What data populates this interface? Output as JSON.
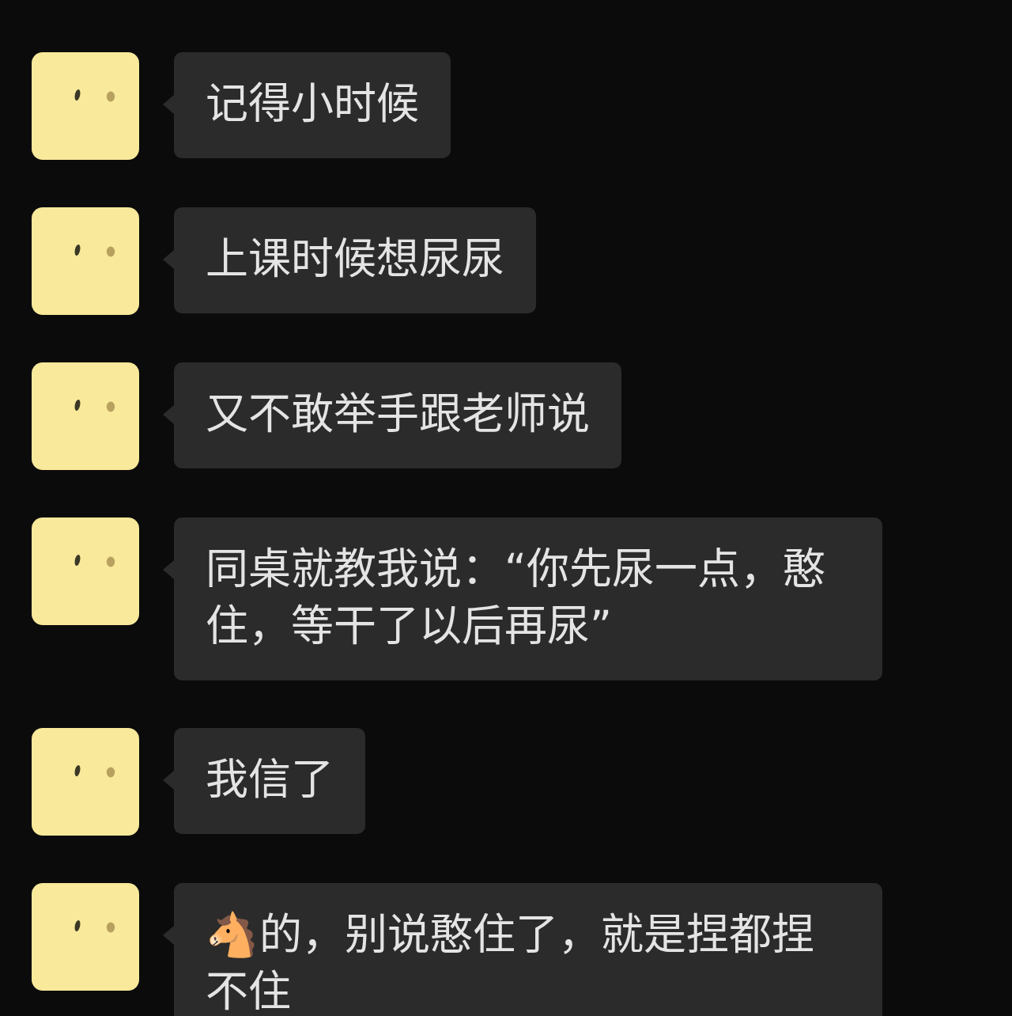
{
  "messages": [
    {
      "text": "记得小时候"
    },
    {
      "text": "上课时候想尿尿"
    },
    {
      "text": "又不敢举手跟老师说"
    },
    {
      "text": "同桌就教我说：“你先尿一点，憨住，等干了以后再尿”"
    },
    {
      "text": "我信了"
    },
    {
      "text": "🐴的，别说憨住了，就是捏都捏不住"
    }
  ]
}
